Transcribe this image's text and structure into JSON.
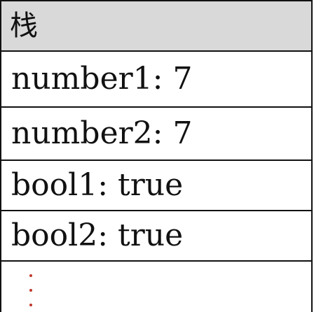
{
  "stack": {
    "title": "栈",
    "items": [
      {
        "label": "number1: 7"
      },
      {
        "label": "number2: 7"
      },
      {
        "label": "bool1: true"
      },
      {
        "label": "bool2: true"
      }
    ],
    "ellipsis_color": "#c0392b"
  }
}
